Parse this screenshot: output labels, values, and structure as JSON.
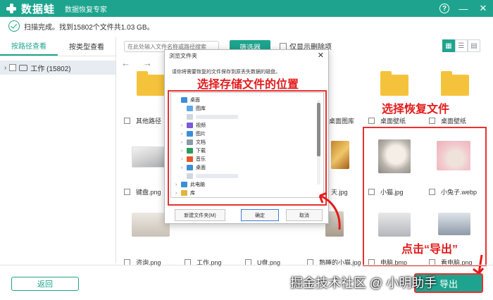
{
  "titlebar": {
    "app_name": "数据蛙",
    "subtitle": "数据恢复专家",
    "help": "?",
    "minimize": "—",
    "close": "✕"
  },
  "status": {
    "text": "扫描完成。找到15802个文件共1.03 GB。"
  },
  "sidebar": {
    "tabs": [
      "按路径查看",
      "按类型查看"
    ],
    "tree": [
      {
        "chevron": "›",
        "label": "工作 (15802)"
      }
    ]
  },
  "toolbar": {
    "search_placeholder": "在此处输入文件名称或路径搜索",
    "filter_label": "筛选器",
    "only_deleted_label": "仅显示删除项",
    "nav_back": "←",
    "nav_forward": "→"
  },
  "files": {
    "row1": [
      "其他路径",
      "桌面图库",
      "桌面壁纸",
      "桌面壁纸"
    ],
    "row2": [
      "键盘.png",
      "天.jpg",
      "小猫.jpg",
      "小兔子.webp"
    ],
    "row3": [
      "咨询.png",
      "工作.png",
      "U盘.png",
      "熟睡的小猫.jpg",
      "电脑.bmp",
      "看电脑.png"
    ]
  },
  "dialog": {
    "title": "浏览文件夹",
    "close": "✕",
    "message": "请你将需要恢复的文件保存到原丢失数据的磁盘。",
    "folders": [
      {
        "chevron": "",
        "label": "桌面",
        "icon_color": "#3b8fd9"
      },
      {
        "chevron": "",
        "label": "图库",
        "icon_color": "#5fa8e8"
      },
      {
        "chevron": "",
        "label": "",
        "icon_color": "#d0d6dd"
      },
      {
        "chevron": "›",
        "label": "视频",
        "icon_color": "#7b5bd6"
      },
      {
        "chevron": "›",
        "label": "图片",
        "icon_color": "#3b8fd9"
      },
      {
        "chevron": "›",
        "label": "文档",
        "icon_color": "#8a9aa8"
      },
      {
        "chevron": "›",
        "label": "下载",
        "icon_color": "#2d9a5c"
      },
      {
        "chevron": "›",
        "label": "音乐",
        "icon_color": "#e5582d"
      },
      {
        "chevron": "›",
        "label": "桌面",
        "icon_color": "#3b8fd9"
      },
      {
        "chevron": "",
        "label": "",
        "icon_color": "#d0d6dd"
      },
      {
        "chevron": "›",
        "label": "此电脑",
        "icon_color": "#3b8fd9"
      },
      {
        "chevron": "›",
        "label": "库",
        "icon_color": "#e2b53b"
      }
    ],
    "new_folder": "新建文件夹(M)",
    "ok": "确定",
    "cancel": "取消"
  },
  "annotations": {
    "choose_location": "选择存储文件的位置",
    "choose_files": "选择恢复文件",
    "click_export": "点击“导出”"
  },
  "bottom": {
    "back": "返回",
    "export": "导出"
  },
  "watermark": "掘金技术社区 @ 小明助手",
  "colors": {
    "accent": "#1ea48e",
    "annotation": "#e83030",
    "folder": "#f5c33b"
  }
}
